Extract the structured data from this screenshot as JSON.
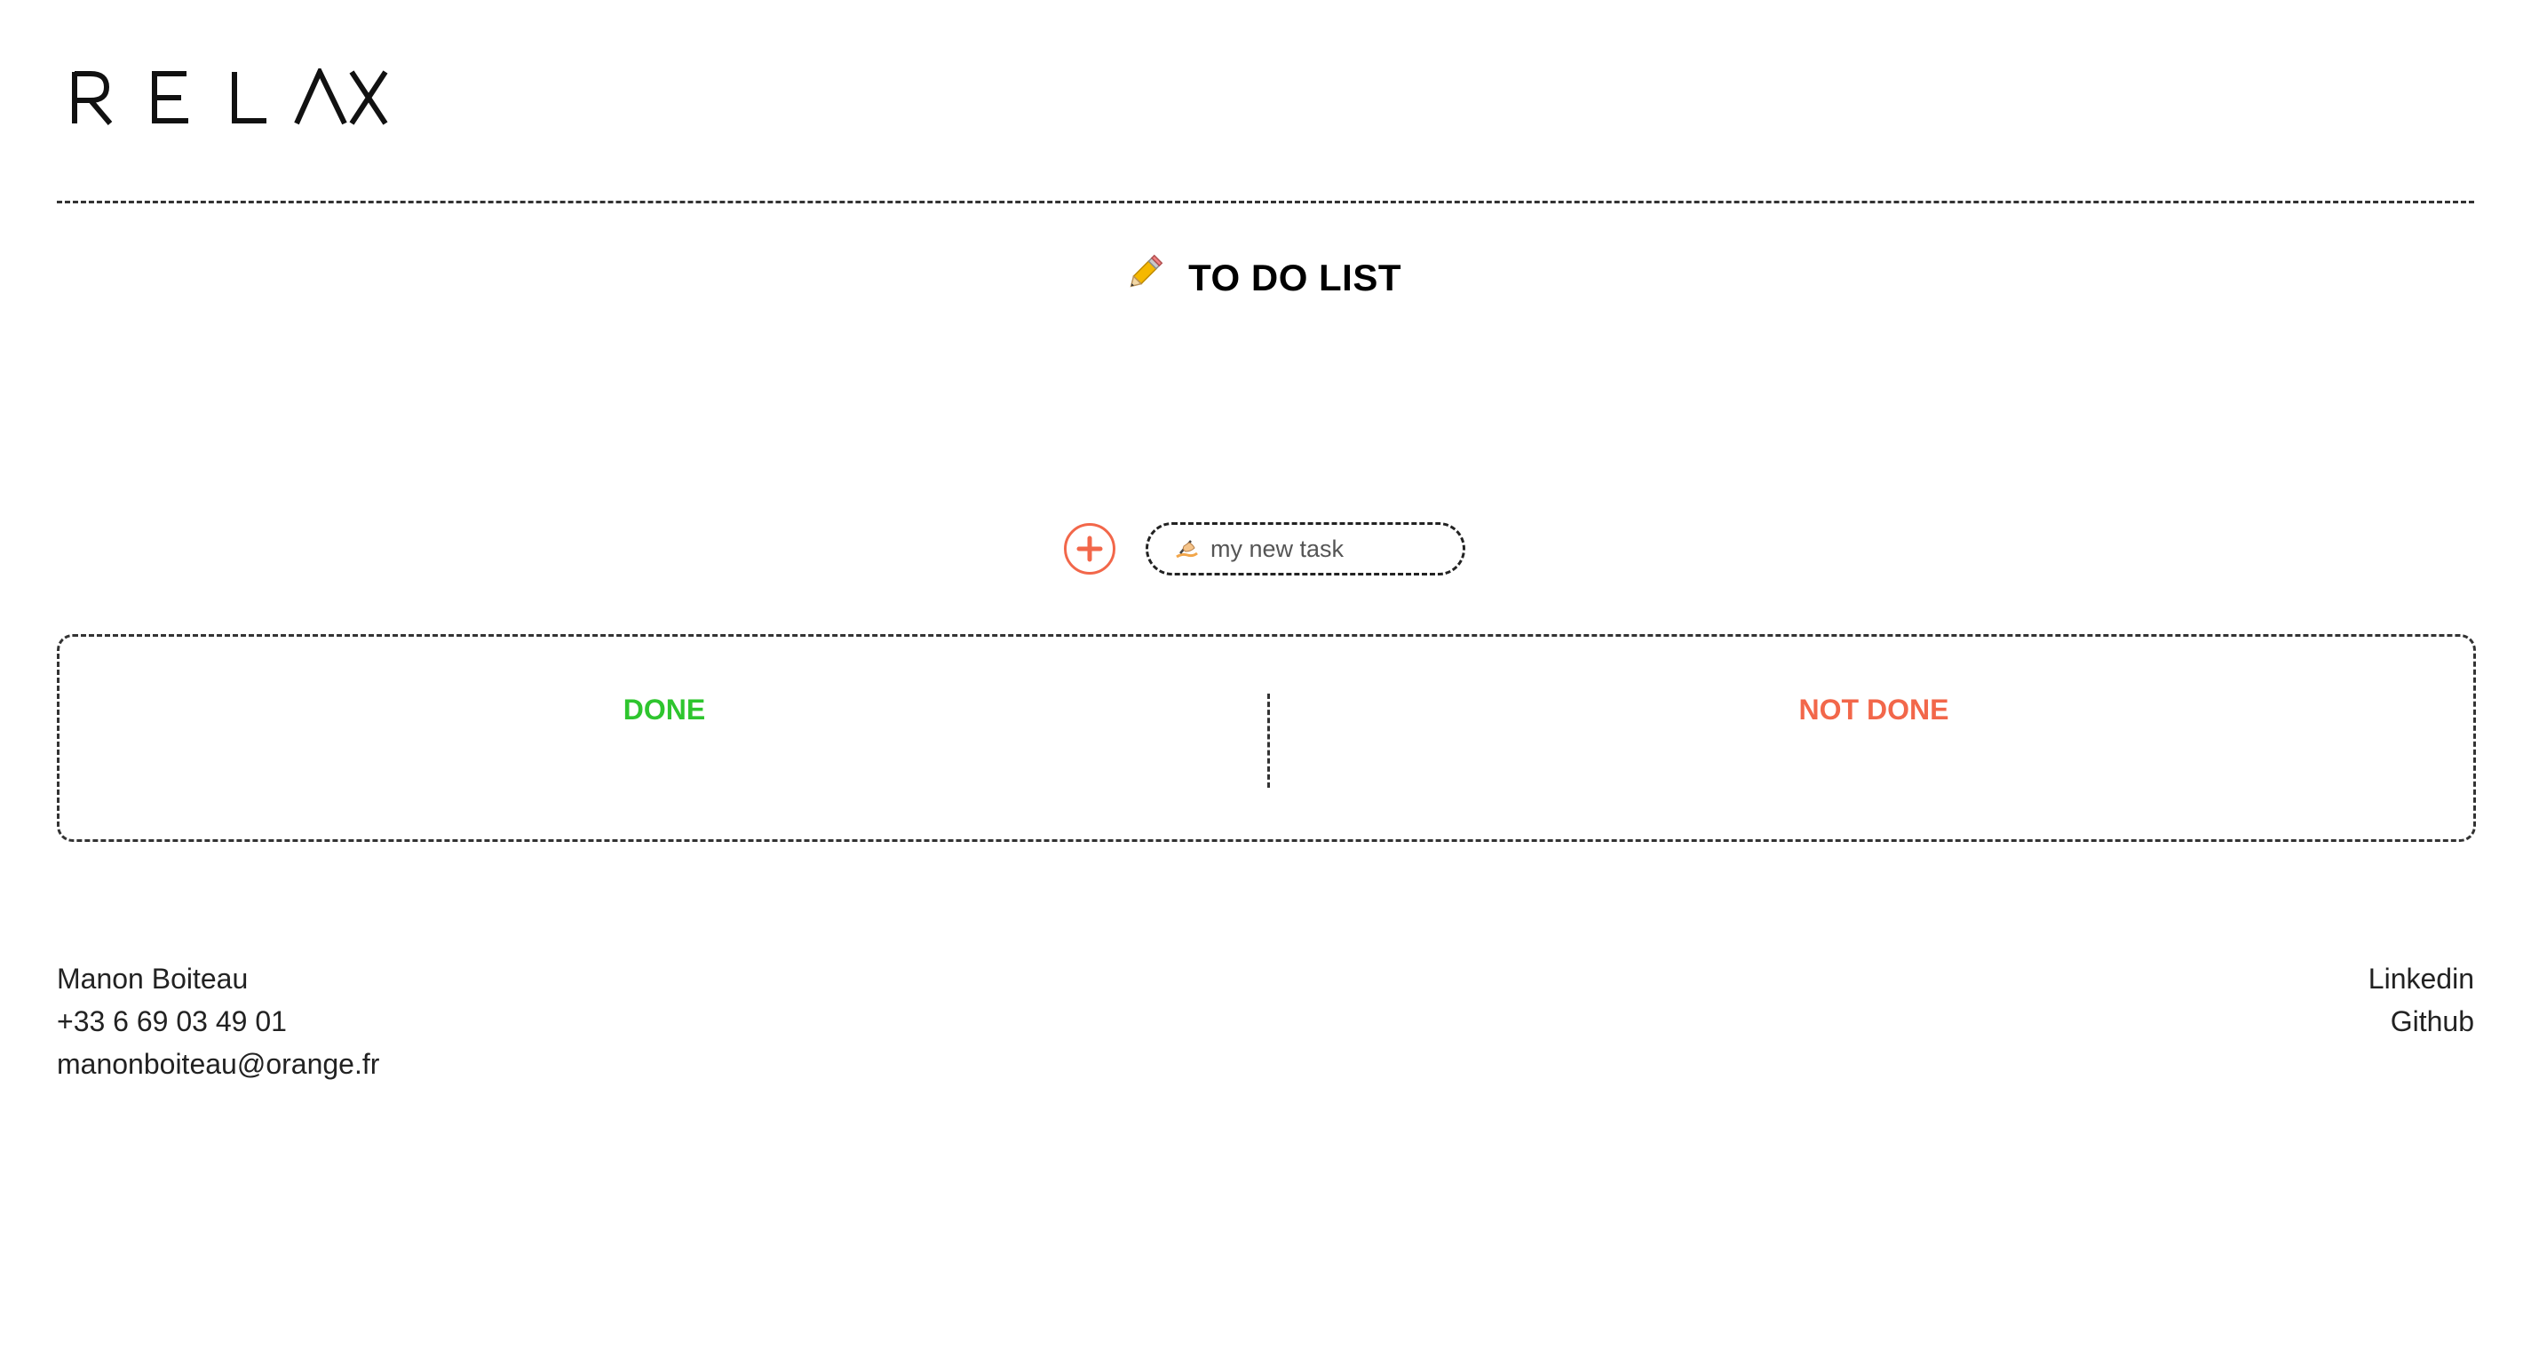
{
  "brand": {
    "logo_text": "RELAX"
  },
  "header": {
    "title": "TO DO LIST",
    "title_icon": "pencil-icon"
  },
  "new_task": {
    "add_icon": "plus-circle-icon",
    "input_icon": "writing-hand-icon",
    "placeholder": "my new task",
    "value": ""
  },
  "board": {
    "done_label": "DONE",
    "not_done_label": "NOT DONE"
  },
  "footer": {
    "name": "Manon Boiteau",
    "phone": "+33 6 69 03 49 01",
    "email": "manonboiteau@orange.fr",
    "links": [
      {
        "label": "Linkedin"
      },
      {
        "label": "Github"
      }
    ]
  },
  "colors": {
    "done": "#2ec52e",
    "not_done": "#f2674a",
    "accent": "#f2674a"
  }
}
